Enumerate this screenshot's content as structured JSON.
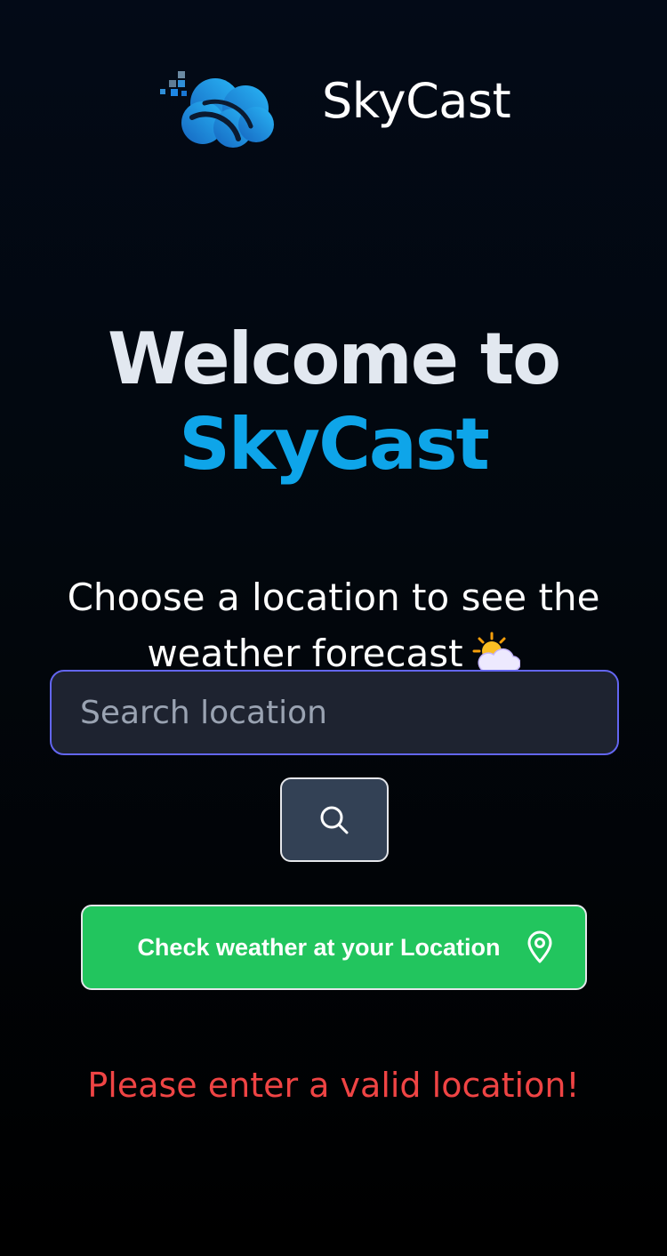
{
  "header": {
    "app_name": "SkyCast",
    "logo_icon": "cloud-logo-icon"
  },
  "hero": {
    "line1": "Welcome to",
    "line2": "SkyCast",
    "subtitle_text": "Choose a location to see the weather forecast",
    "subtitle_emoji": "sun-behind-cloud-emoji"
  },
  "search": {
    "value": "",
    "placeholder": "Search location",
    "button_icon": "search-icon"
  },
  "location_button": {
    "label": "Check weather at your Location",
    "icon": "map-pin-icon"
  },
  "error": {
    "message": "Please enter a valid location!"
  },
  "colors": {
    "accent": "#0ea5e9",
    "success": "#22c55e",
    "error": "#ef4444",
    "input_border": "#6366f1",
    "input_bg": "#1e2330",
    "button_bg": "#334155"
  }
}
